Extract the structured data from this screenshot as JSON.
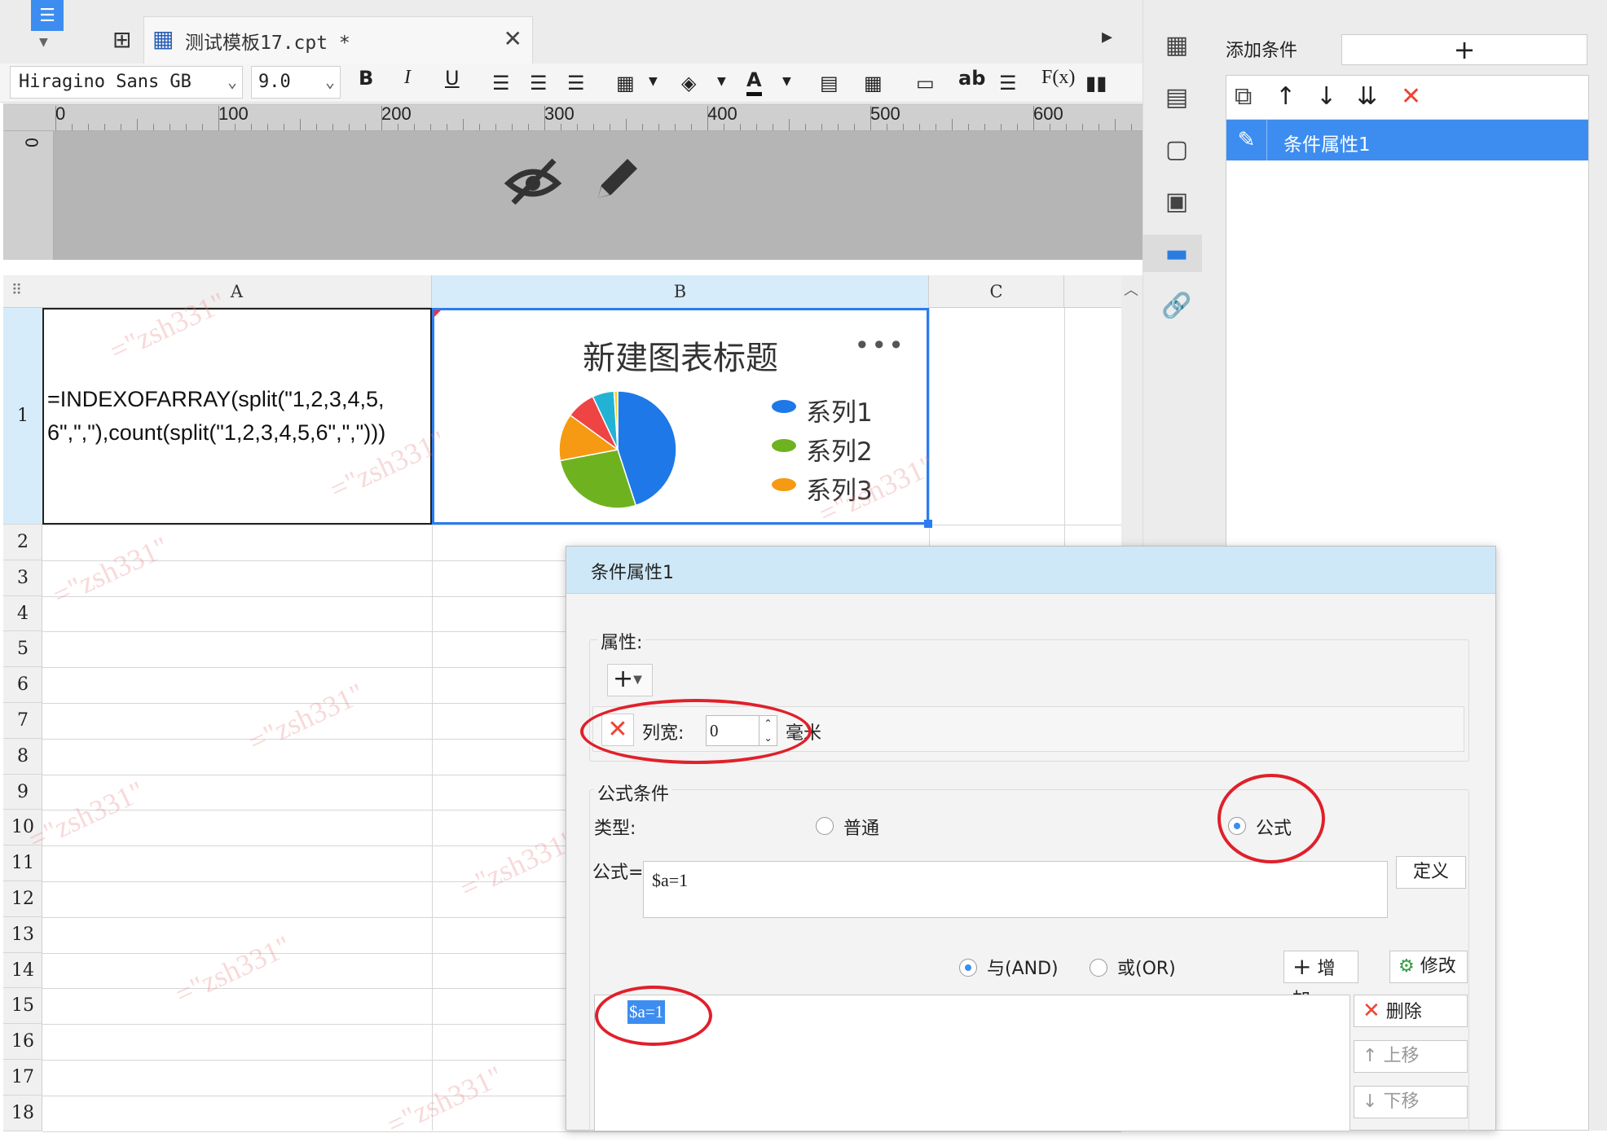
{
  "tab": {
    "title": "测试模板17.cpt *",
    "close_label": "✕"
  },
  "format_toolbar": {
    "font_name": "Hiragino Sans GB",
    "font_size": "9.0",
    "bold": "B",
    "italic": "I",
    "underline": "U",
    "text_label": "ab",
    "formula_label": "F(x)"
  },
  "ruler": {
    "labels": [
      "0",
      "100",
      "200",
      "300",
      "400",
      "500",
      "600"
    ],
    "vertical_zero": "0"
  },
  "grid": {
    "columns": [
      "A",
      "B",
      "C"
    ],
    "rows": [
      "1",
      "2",
      "3",
      "4",
      "5",
      "6",
      "7",
      "8",
      "9",
      "10",
      "11",
      "12",
      "13",
      "14",
      "15",
      "16",
      "17",
      "18"
    ],
    "cell_a1_line1": "=INDEXOFARRAY(split(\"1,2,3,4,5,",
    "cell_a1_line2": "6\",\",\"),count(split(\"1,2,3,4,5,6\",\",\")))"
  },
  "chart": {
    "title": "新建图表标题",
    "more": "•••",
    "legend": [
      {
        "name": "系列1",
        "color": "#1e78e8"
      },
      {
        "name": "系列2",
        "color": "#6fb21f"
      },
      {
        "name": "系列3",
        "color": "#f59a12"
      }
    ]
  },
  "chart_data": {
    "type": "pie",
    "title": "新建图表标题",
    "slices": [
      {
        "color": "#1e78e8",
        "value": 45
      },
      {
        "color": "#6fb21f",
        "value": 27
      },
      {
        "color": "#f59a12",
        "value": 13
      },
      {
        "color": "#ef4444",
        "value": 8
      },
      {
        "color": "#22b3d4",
        "value": 6
      },
      {
        "color": "#f5d12a",
        "value": 1
      }
    ],
    "legend": [
      "系列1",
      "系列2",
      "系列3"
    ],
    "legend_position": "right"
  },
  "watermark": "=\"zsh331\"",
  "right_panel": {
    "add_condition_label": "添加条件",
    "add_symbol": "+",
    "selected_item": "条件属性1"
  },
  "dialog": {
    "title": "条件属性1",
    "attributes_label": "属性:",
    "attr_label": "列宽:",
    "attr_value": "0",
    "attr_unit": "毫米",
    "formula_section_label": "公式条件",
    "type_label": "类型:",
    "type_normal": "普通",
    "type_formula": "公式",
    "formula_label": "公式=",
    "formula_value": "$a=1",
    "define_button": "定义",
    "and_label": "与(AND)",
    "or_label": "或(OR)",
    "add_button": "增加",
    "modify_button": "修改",
    "delete_button": "删除",
    "up_button": "上移",
    "down_button": "下移",
    "condition_item": "$a=1"
  },
  "colors": {
    "accent": "#3d8df0",
    "selection_border": "#2b7cf2",
    "annotation_red": "#e0202a"
  }
}
